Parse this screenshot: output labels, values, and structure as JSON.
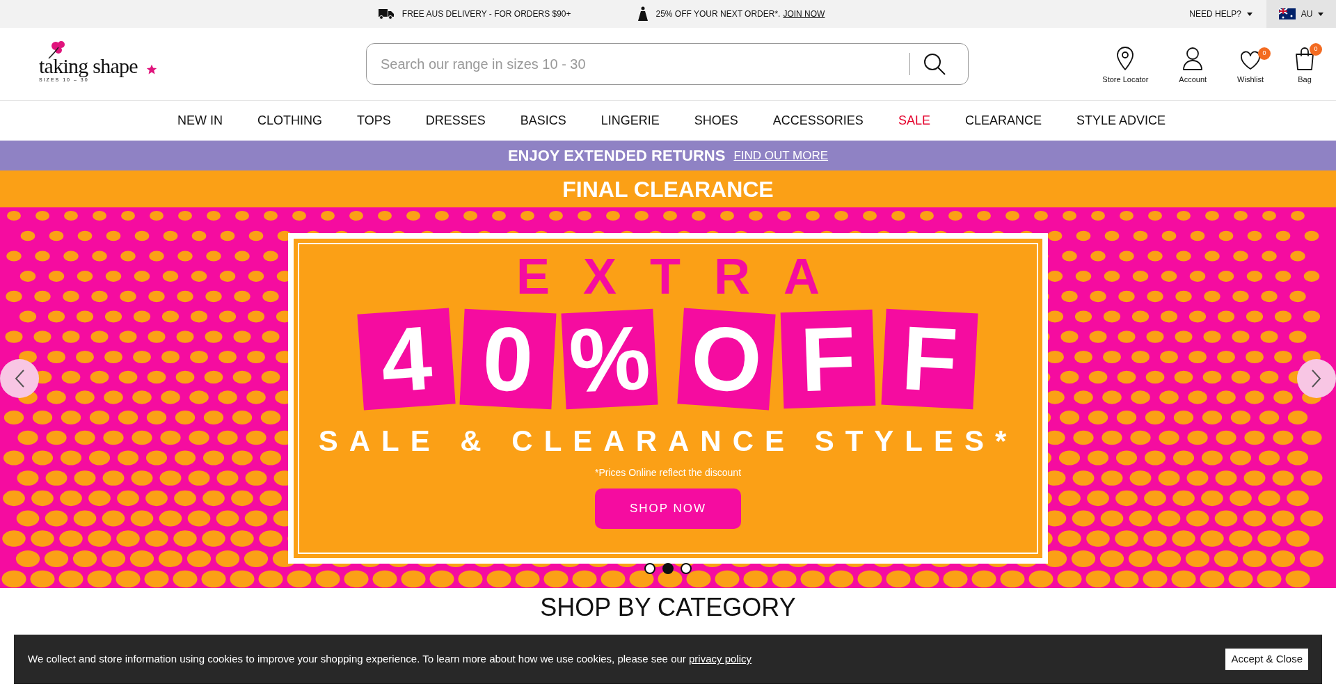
{
  "top_bar": {
    "promos": [
      {
        "kind": "delivery",
        "text": "FREE AUS DELIVERY - FOR ORDERS $90+"
      },
      {
        "kind": "offer",
        "text": "25% OFF YOUR NEXT ORDER*.",
        "link": "JOIN NOW"
      }
    ],
    "help": "NEED HELP?",
    "country": "AU"
  },
  "header": {
    "logo": {
      "name": "taking shape",
      "tagline": "SIZES 10 – 30"
    },
    "search": {
      "placeholder": "Search our range in sizes 10 - 30"
    },
    "actions": [
      {
        "kind": "pin",
        "label": "Store Locator"
      },
      {
        "kind": "user",
        "label": "Account"
      },
      {
        "kind": "heart",
        "label": "Wishlist",
        "count": "0"
      },
      {
        "kind": "bag",
        "label": "Bag",
        "count": "0"
      }
    ]
  },
  "nav": [
    {
      "label": "NEW IN",
      "sale": false
    },
    {
      "label": "CLOTHING",
      "sale": false
    },
    {
      "label": "TOPS",
      "sale": false
    },
    {
      "label": "DRESSES",
      "sale": false
    },
    {
      "label": "BASICS",
      "sale": false
    },
    {
      "label": "LINGERIE",
      "sale": false
    },
    {
      "label": "SHOES",
      "sale": false
    },
    {
      "label": "ACCESSORIES",
      "sale": false
    },
    {
      "label": "SALE",
      "sale": true
    },
    {
      "label": "CLEARANCE",
      "sale": false
    },
    {
      "label": "STYLE ADVICE",
      "sale": false
    }
  ],
  "returns_bar": {
    "text": "ENJOY EXTENDED RETURNS",
    "link": "FIND OUT MORE"
  },
  "clearance_bar": {
    "text": "FINAL CLEARANCE"
  },
  "hero": {
    "kicker": "EXTRA",
    "tiles": [
      "4",
      "0",
      "%",
      "O",
      "F",
      "F"
    ],
    "subtitle": "SALE & CLEARANCE STYLES*",
    "note": "*Prices Online reflect the discount",
    "button": "SHOP NOW",
    "slides": [
      {
        "selected": false
      },
      {
        "selected": true
      },
      {
        "selected": false
      }
    ]
  },
  "section": {
    "heading": "SHOP BY CATEGORY"
  },
  "cookie_bar": {
    "text": "We collect and store information using cookies to improve your shopping experience. To learn more about how we use cookies, please see our",
    "link": "privacy policy",
    "button": "Accept & Close"
  }
}
